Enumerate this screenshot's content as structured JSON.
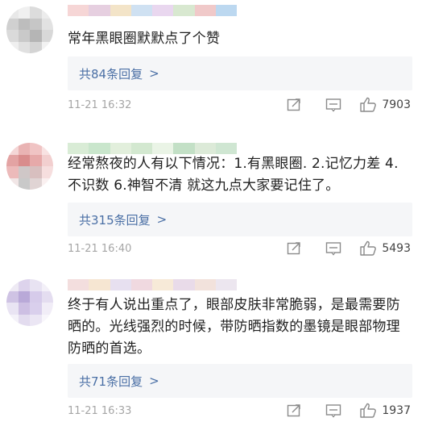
{
  "comments": [
    {
      "text": "常年黑眼圈默默点了个赞",
      "reply_label": "共84条回复",
      "timestamp": "11-21 16:32",
      "likes": "7903",
      "avatar_colors": [
        "#e8e8e8",
        "#f0f0f0",
        "#dcdcdc",
        "#ececec",
        "#d0d0d0",
        "#bdbdbd",
        "#c6c6c6",
        "#e2e2e2",
        "#dadada",
        "#c9c9c9",
        "#b5b5b5",
        "#d8d8d8",
        "#efefef",
        "#e0e0e0",
        "#d4d4d4",
        "#f2f2f2"
      ],
      "name_colors": [
        "#f6d6d6",
        "#e6cfe0",
        "#f3e4c8",
        "#cfe1f2",
        "#e9d7ef",
        "#d8e8d0",
        "#f0c9c9",
        "#bcd8f0"
      ]
    },
    {
      "text": "经常熬夜的人有以下情况：1.有黑眼圈. 2.记忆力差 4.不识数 6.神智不清  就这九点大家要记住了。",
      "reply_label": "共315条回复",
      "timestamp": "11-21 16:40",
      "likes": "5493",
      "avatar_colors": [
        "#f4d6d6",
        "#e9b3b3",
        "#f0c4c4",
        "#f8e2e2",
        "#e3a3a3",
        "#d98c8c",
        "#e6a9a9",
        "#f2cfcf",
        "#ecbaba",
        "#cfc7c7",
        "#d8bfbf",
        "#f6dede",
        "#f1e6e6",
        "#c9c9c9",
        "#e0d4d4",
        "#faf0f0"
      ],
      "name_colors": [
        "#d9ecd6",
        "#c9e6cc",
        "#e2efdc",
        "#d3e8d0",
        "#eaf4e6",
        "#c3e0c6",
        "#dcead8",
        "#cfe6d2"
      ]
    },
    {
      "text": "终于有人说出重点了，眼部皮肤非常脆弱，是最需要防晒的。光线强烈的时候，带防晒指数的墨镜是眼部物理防晒的首选。",
      "reply_label": "共71条回复",
      "timestamp": "11-21 16:33",
      "likes": "1937",
      "avatar_colors": [
        "#eeeaf4",
        "#ddd3ec",
        "#e8e3f2",
        "#f3f0f8",
        "#cfc3e4",
        "#b9a9d8",
        "#d6cbea",
        "#e4ddf0",
        "#e9e4f3",
        "#cdbfe3",
        "#d9cfec",
        "#f1edf7",
        "#f4f2f9",
        "#e3dcef",
        "#ebe6f4",
        "#f8f6fb"
      ],
      "name_colors": [
        "#f3dede",
        "#f6e6d2",
        "#e7e0f0",
        "#f0d9e0",
        "#f7ead8",
        "#e9dbe9",
        "#f2e2dc",
        "#ece6ef"
      ]
    }
  ],
  "icons": {
    "share": "share-icon",
    "comment": "comment-icon",
    "like": "thumbs-up-icon",
    "chevron": "chevron-right-icon"
  },
  "colors": {
    "reply_link": "#4a6fa5",
    "reply_bg": "#f5f6f8",
    "timestamp": "#a6a6a6"
  }
}
